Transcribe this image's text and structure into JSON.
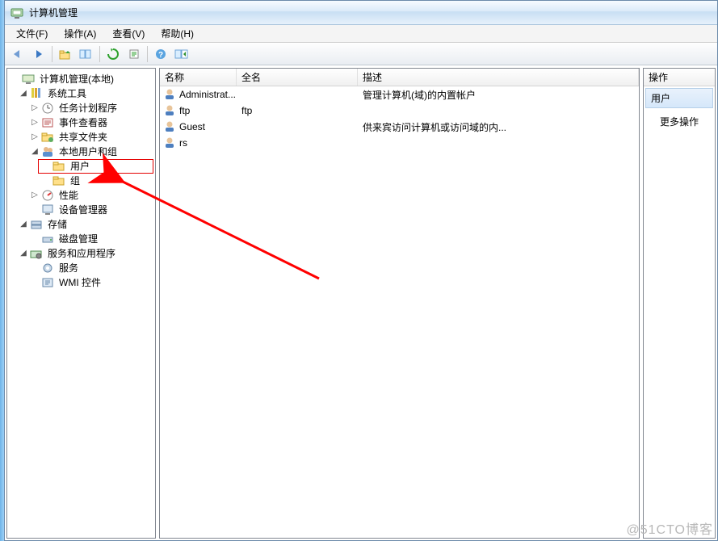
{
  "title": "计算机管理",
  "menu": {
    "file": "文件(F)",
    "action": "操作(A)",
    "view": "查看(V)",
    "help": "帮助(H)"
  },
  "toolbar_icons": [
    "back",
    "forward",
    "up",
    "views",
    "refresh",
    "export",
    "help",
    "show-hide"
  ],
  "tree": {
    "root": "计算机管理(本地)",
    "system_tools": "系统工具",
    "task_scheduler": "任务计划程序",
    "event_viewer": "事件查看器",
    "shared_folders": "共享文件夹",
    "local_users": "本地用户和组",
    "users": "用户",
    "groups": "组",
    "performance": "性能",
    "device_manager": "设备管理器",
    "storage": "存储",
    "disk_management": "磁盘管理",
    "services_apps": "服务和应用程序",
    "services": "服务",
    "wmi": "WMI 控件"
  },
  "list": {
    "columns": {
      "name": "名称",
      "full": "全名",
      "desc": "描述"
    },
    "rows": [
      {
        "icon": "user",
        "name": "Administrat...",
        "full": "",
        "desc": "管理计算机(域)的内置帐户"
      },
      {
        "icon": "user",
        "name": "ftp",
        "full": "ftp",
        "desc": ""
      },
      {
        "icon": "user",
        "name": "Guest",
        "full": "",
        "desc": "供来宾访问计算机或访问域的内..."
      },
      {
        "icon": "user",
        "name": "rs",
        "full": "",
        "desc": ""
      }
    ]
  },
  "actions": {
    "header": "操作",
    "title": "用户",
    "more": "更多操作"
  },
  "watermark": "@51CTO博客"
}
